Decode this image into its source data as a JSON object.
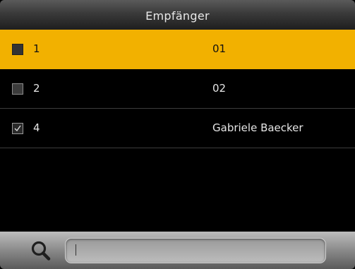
{
  "titlebar": {
    "title": "Empfänger"
  },
  "recipients": [
    {
      "id": "1",
      "name": "01",
      "checked": false,
      "selected": true
    },
    {
      "id": "2",
      "name": "02",
      "checked": false,
      "selected": false
    },
    {
      "id": "4",
      "name": "Gabriele Baecker",
      "checked": true,
      "selected": false
    }
  ],
  "search": {
    "value": "",
    "icon": "search-icon"
  },
  "colors": {
    "highlight": "#f2b100",
    "background": "#000000"
  }
}
